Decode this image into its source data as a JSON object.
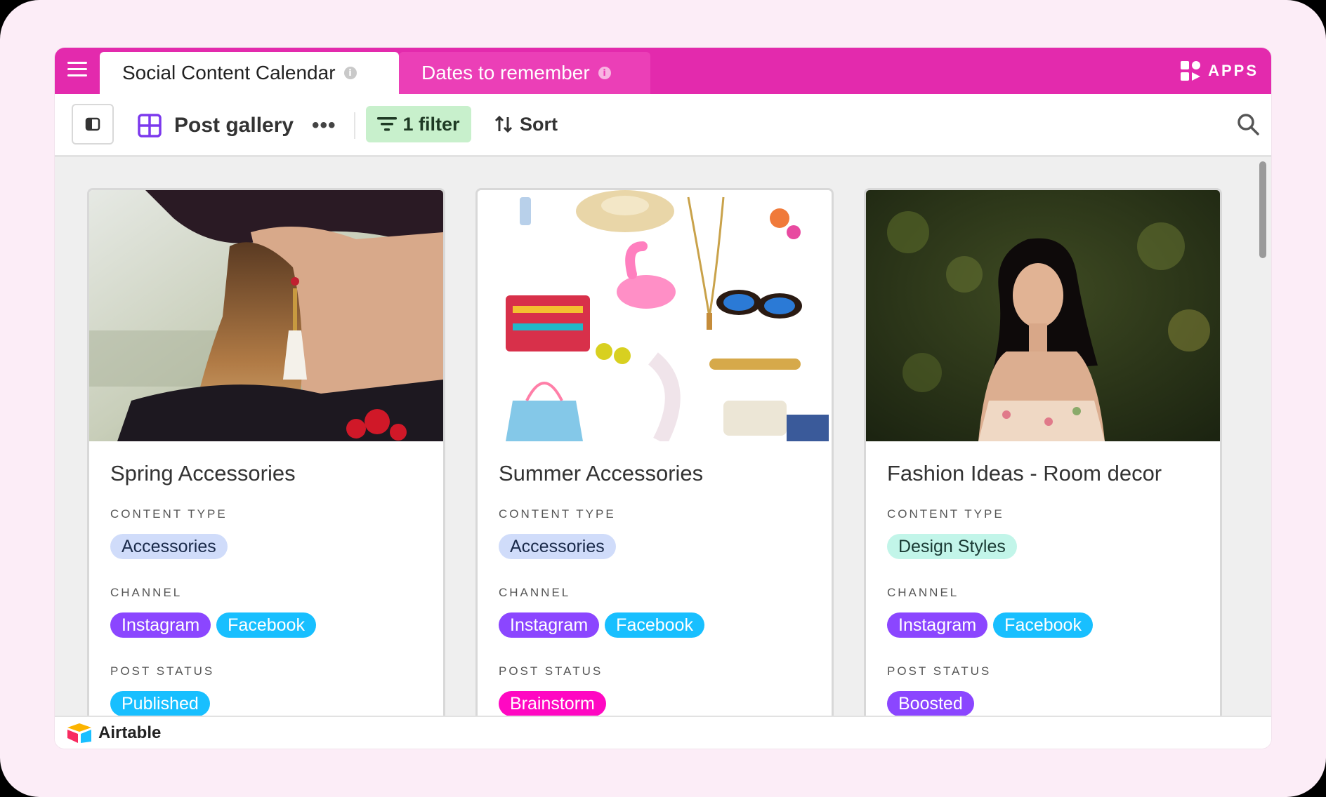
{
  "tabs": [
    {
      "label": "Social Content Calendar",
      "active": true
    },
    {
      "label": "Dates to remember",
      "active": false
    }
  ],
  "apps_label": "APPS",
  "toolbar": {
    "view_name": "Post gallery",
    "more": "•••",
    "filter_label": "1 filter",
    "sort_label": "Sort"
  },
  "cards": [
    {
      "title": "Spring Accessories",
      "content_type_label": "CONTENT TYPE",
      "content_type": "Accessories",
      "channel_label": "CHANNEL",
      "channels": [
        "Instagram",
        "Facebook"
      ],
      "post_status_label": "POST STATUS",
      "post_status": "Published"
    },
    {
      "title": "Summer Accessories",
      "content_type_label": "CONTENT TYPE",
      "content_type": "Accessories",
      "channel_label": "CHANNEL",
      "channels": [
        "Instagram",
        "Facebook"
      ],
      "post_status_label": "POST STATUS",
      "post_status": "Brainstorm"
    },
    {
      "title": "Fashion Ideas - Room decor",
      "content_type_label": "CONTENT TYPE",
      "content_type": "Design Styles",
      "channel_label": "CHANNEL",
      "channels": [
        "Instagram",
        "Facebook"
      ],
      "post_status_label": "POST STATUS",
      "post_status": "Boosted"
    }
  ],
  "footer": {
    "brand": "Airtable"
  },
  "colors": {
    "topbar": "#e32aad",
    "inactive_tab": "#eb3fb7",
    "filter_bg": "#c8f0cc",
    "tag_accessories": "#d0dcfa",
    "tag_design_styles": "#c2f5e9",
    "tag_instagram": "#8b46ff",
    "tag_facebook": "#18bfff",
    "tag_published": "#18bfff",
    "tag_brainstorm": "#ff08c2",
    "tag_boosted": "#8b46ff"
  }
}
